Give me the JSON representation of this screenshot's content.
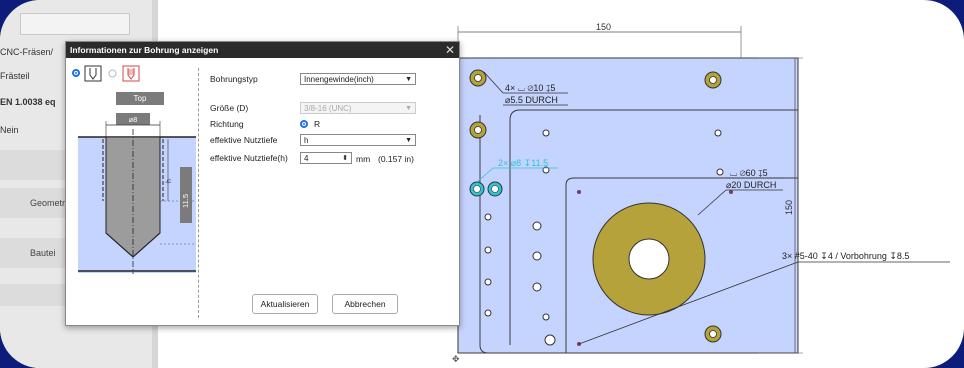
{
  "left_panel": {
    "field1": "CNC-Fräsen/",
    "field2": "Frästeil",
    "field3": "EN 1.0038 eq",
    "field4": "Nein",
    "button1": "Geometr",
    "button2": "Bautei"
  },
  "drawing": {
    "dim_top": "150",
    "dim_right": "150",
    "callout_counterbore": "4× ⌴ ⌀10 ↧5",
    "callout_through": "⌀5.5 DURCH",
    "callout_small": "2× ⌀8 ↧11.5",
    "callout_large_cb": "⌴ ⌀60 ↧5",
    "callout_large_through": "⌀20 DURCH",
    "callout_thread": "3× #5-40 ↧4 / Vorbohrung ↧8.5"
  },
  "dialog": {
    "title": "Informationen zur Bohrung anzeigen",
    "close_glyph": "✕",
    "view_label": "Top",
    "dia_label": "⌀8",
    "h_label": "h",
    "depth_label": "11.5",
    "form": {
      "type_label": "Bohrungstyp",
      "type_value": "Innengewinde(inch)",
      "size_label": "Größe (D)",
      "size_value": "3/8-16 (UNC)",
      "direction_label": "Richtung",
      "direction_value": "R",
      "eff_label": "effektive Nutztiefe",
      "eff_value": "h",
      "effh_label": "effektive Nutztiefe(h)",
      "effh_value": "4",
      "effh_unit": "mm",
      "effh_inch": "(0.157 in)"
    },
    "update_button": "Aktualisieren",
    "cancel_button": "Abbrechen"
  },
  "colors": {
    "plate": "#c5d3ff",
    "counterbore": "#b5a23a",
    "highlight": "#2ec4d6",
    "accent": "#1a73e8",
    "background": "#0d1b7a"
  }
}
